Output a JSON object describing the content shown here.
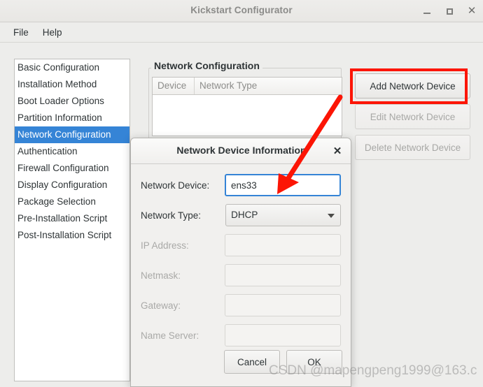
{
  "window": {
    "title": "Kickstart Configurator",
    "controls": {
      "minimize": "_",
      "maximize": "□",
      "close": "✕"
    }
  },
  "menubar": {
    "items": [
      {
        "label": "File"
      },
      {
        "label": "Help"
      }
    ]
  },
  "sidebar": {
    "selected_index": 4,
    "items": [
      {
        "label": "Basic Configuration"
      },
      {
        "label": "Installation Method"
      },
      {
        "label": "Boot Loader Options"
      },
      {
        "label": "Partition Information"
      },
      {
        "label": "Network Configuration"
      },
      {
        "label": "Authentication"
      },
      {
        "label": "Firewall Configuration"
      },
      {
        "label": "Display Configuration"
      },
      {
        "label": "Package Selection"
      },
      {
        "label": "Pre-Installation Script"
      },
      {
        "label": "Post-Installation Script"
      }
    ]
  },
  "main": {
    "group_title": "Network Configuration",
    "table": {
      "columns": [
        "Device",
        "Network Type"
      ],
      "rows": []
    },
    "buttons": [
      {
        "label": "Add Network Device",
        "enabled": true
      },
      {
        "label": "Edit Network Device",
        "enabled": false
      },
      {
        "label": "Delete Network Device",
        "enabled": false
      }
    ]
  },
  "dialog": {
    "title": "Network Device Information",
    "close_label": "✕",
    "fields": [
      {
        "label": "Network Device:",
        "value": "ens33",
        "type": "text",
        "enabled": true
      },
      {
        "label": "Network Type:",
        "value": "DHCP",
        "type": "combo",
        "enabled": true
      },
      {
        "label": "IP Address:",
        "value": "",
        "type": "text",
        "enabled": false
      },
      {
        "label": "Netmask:",
        "value": "",
        "type": "text",
        "enabled": false
      },
      {
        "label": "Gateway:",
        "value": "",
        "type": "text",
        "enabled": false
      },
      {
        "label": "Name Server:",
        "value": "",
        "type": "text",
        "enabled": false
      }
    ],
    "cancel_label": "Cancel",
    "ok_label": "OK"
  },
  "annotation": {
    "highlight_color": "#fc1505",
    "arrow_color": "#fc1505"
  },
  "watermark": {
    "text": "CSDN @mapengpeng1999@163.c"
  }
}
